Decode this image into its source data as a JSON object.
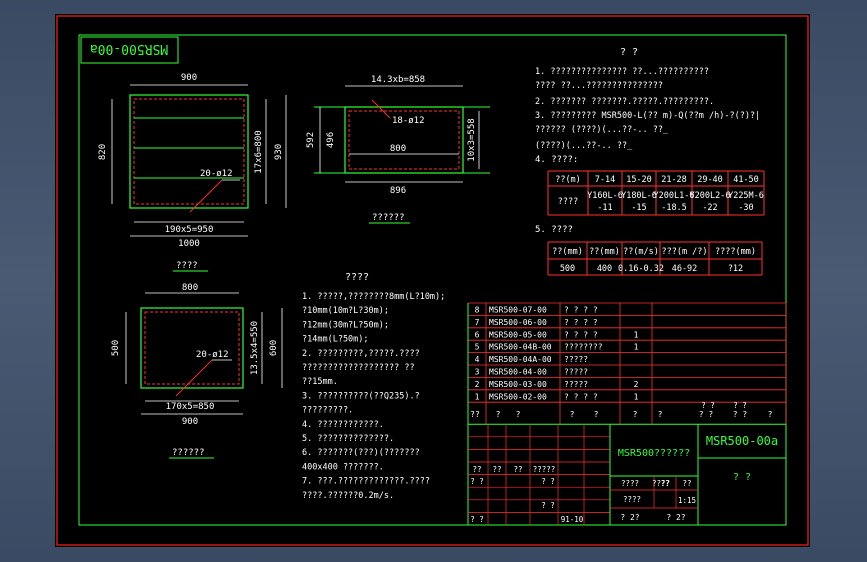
{
  "drawing": {
    "stamp": "MSR500-00a",
    "title": "? ?",
    "views": {
      "frame_top": {
        "dims": [
          "900",
          "820",
          "930",
          "17x6=800",
          "1000",
          "190x5=950"
        ],
        "callout": "20-ø12",
        "caption": "????"
      },
      "side": {
        "dims": [
          "14.3xb=858",
          "18-ø12",
          "800",
          "896",
          "10x3=558",
          "592",
          "496"
        ],
        "caption": "??????"
      },
      "frame_bottom": {
        "dims": [
          "800",
          "500",
          "600",
          "13.5x4=550",
          "170x5=850",
          "900"
        ],
        "callout": "20-ø12",
        "caption": "??????"
      }
    },
    "notes_left": {
      "heading": "????",
      "lines": [
        "1. ?????,????????8mm(L?10m);",
        "   ?10mm(10m?L?30m);",
        "   ?12mm(30m?L?50m);",
        "   ?14mm(L?50m);",
        "2. ?????????,?????.????",
        "   ??????????????????? ??",
        "   ??15mm.",
        "3. ??????????(??Q235).?",
        "   ?????????.",
        "4. ????????????.",
        "5. ??????????????.",
        "6. ???????(???)(???????",
        "   400x400 ???????.",
        "7. ???.?????????????.????",
        "   ????.??????0.2m/s."
      ]
    },
    "notes_right": {
      "heading": "?  ?",
      "lines": [
        "1. ???????????????  ??...??????????",
        "   ????  ??...???????????????",
        "2. ??????? ???????.?????.?????????.",
        "3. ????????? MSR500-L(?? m)-Q(??m /h)-?(?)?|",
        "   ??????     (????)(...??-.. ??_",
        "              (????)(...??-.. ??_"
      ],
      "item4": "4. ????:",
      "item5": "5. ????"
    },
    "table1": {
      "header": [
        "??(m)",
        "7-14",
        "15-20",
        "21-28",
        "29-40",
        "41-50"
      ],
      "row_label": "????",
      "cells": [
        [
          "Y160L-6",
          "-11"
        ],
        [
          "Y180L-6",
          "-15"
        ],
        [
          "Y200L1-6",
          "-18.5"
        ],
        [
          "Y200L2-6",
          "-22"
        ],
        [
          "Y225M-6",
          "-30"
        ]
      ]
    },
    "table2": {
      "header": [
        "??(mm)",
        "??(mm)",
        "??(m/s)",
        "???(m /?)",
        "????(mm)"
      ],
      "values": [
        "500",
        "400",
        "0.16-0.32",
        "46-92",
        "?12"
      ]
    },
    "bom": {
      "rows": [
        {
          "no": "8",
          "code": "MSR500-07-00",
          "name": "? ? ? ?",
          "qty": ""
        },
        {
          "no": "7",
          "code": "MSR500-06-00",
          "name": "? ? ? ?",
          "qty": ""
        },
        {
          "no": "6",
          "code": "MSR500-05-00",
          "name": "? ? ? ?",
          "qty": "1"
        },
        {
          "no": "5",
          "code": "MSR500-04B-00",
          "name": "????????",
          "qty": "1"
        },
        {
          "no": "4",
          "code": "MSR500-04A-00",
          "name": "?????",
          "qty": ""
        },
        {
          "no": "3",
          "code": "MSR500-04-00",
          "name": "?????",
          "qty": ""
        },
        {
          "no": "2",
          "code": "MSR500-03-00",
          "name": "?????",
          "qty": "2"
        },
        {
          "no": "1",
          "code": "MSR500-02-00",
          "name": "? ? ? ?",
          "qty": "1"
        }
      ],
      "header": [
        "??",
        "?",
        "?",
        "?",
        "?",
        "?",
        "?",
        "? ?",
        "? ?",
        "?"
      ],
      "header2": [
        "? ?",
        "? ?"
      ]
    },
    "titleblock": {
      "name": "MSR500??????",
      "code": "MSR500-00a",
      "company": "?  ?",
      "row_labels": [
        "??",
        "??",
        "??",
        "?????",
        "????",
        "????"
      ],
      "sign_labels": [
        "? ?",
        "? ?",
        "? ?",
        "? ?"
      ],
      "stage": "????",
      "scale_label": "??",
      "sheet_label": "??",
      "scale": "1:15",
      "date": "91-10",
      "sheets": [
        "? 2?",
        "? 2?"
      ]
    }
  }
}
